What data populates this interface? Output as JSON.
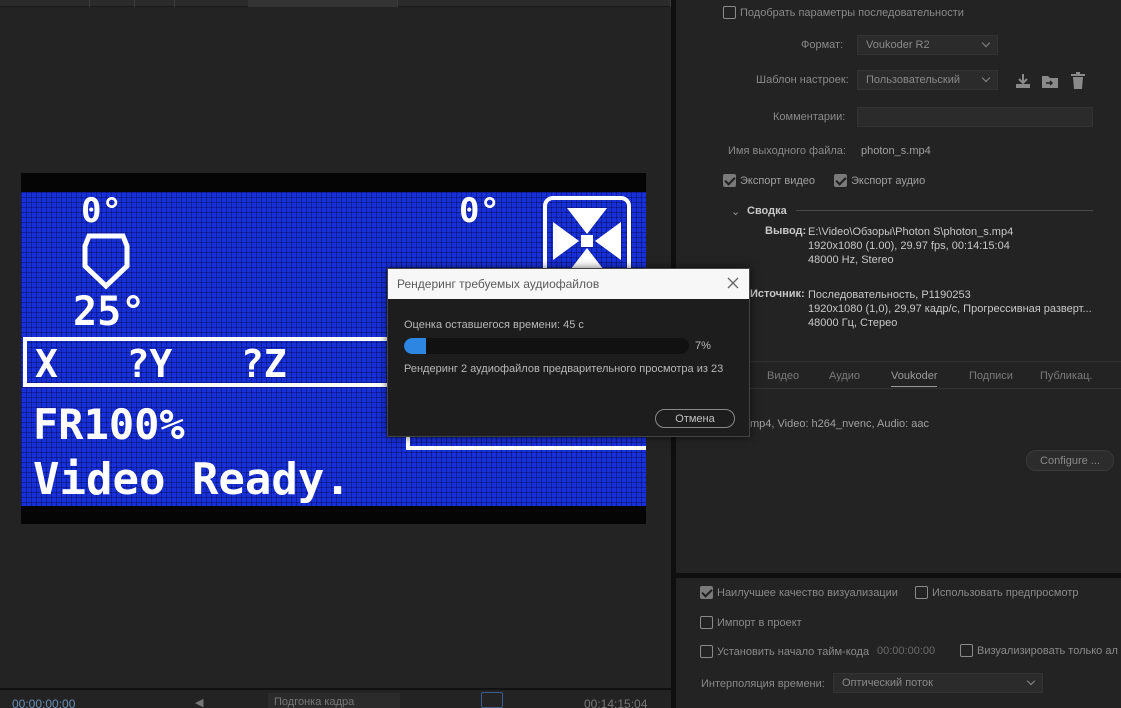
{
  "export_settings": {
    "match_sequence_label": "Подобрать параметры последовательности",
    "format_label": "Формат:",
    "format_value": "Voukoder R2",
    "preset_label": "Шаблон настроек:",
    "preset_value": "Пользовательский",
    "comments_label": "Комментарии:",
    "comments_value": "",
    "output_name_label": "Имя выходного файла:",
    "output_name_value": "photon_s.mp4",
    "export_video_label": "Экспорт видео",
    "export_audio_label": "Экспорт аудио",
    "summary_header": "Сводка",
    "output_label": "Вывод:",
    "output_lines": [
      "E:\\Video\\Обзоры\\Photon S\\photon_s.mp4",
      "1920x1080 (1.00), 29.97 fps, 00:14:15:04",
      "48000 Hz, Stereo"
    ],
    "source_label": "Источник:",
    "source_lines": [
      "Последовательность, P1190253",
      "1920x1080 (1,0), 29,97 кадр/с, Прогрессивная разверт...",
      "48000 Гц, Стерео"
    ],
    "tabs": [
      {
        "label": "Видео"
      },
      {
        "label": "Аудио"
      },
      {
        "label": "Voukoder"
      },
      {
        "label": "Подписи"
      },
      {
        "label": "Публикац."
      }
    ],
    "voukoder_summary": "mp4, Video: h264_nvenc, Audio: aac",
    "configure_label": "Configure ..."
  },
  "render_options": {
    "max_quality_label": "Наилучшее качество визуализации",
    "use_previews_label": "Использовать предпросмотр",
    "import_label": "Импорт в проект",
    "set_start_tc_label": "Установить начало тайм-кода",
    "start_tc_value": "00:00:00:00",
    "render_alpha_label": "Визуализировать только ал",
    "time_interp_label": "Интерполяция времени:",
    "time_interp_value": "Оптический поток"
  },
  "modal": {
    "title": "Рендеринг требуемых аудиофайлов",
    "time_remaining": "Оценка оставшегося времени: 45 с",
    "progress_fraction": 0.07,
    "progress_label": "7%",
    "status": "Рендеринг 2 аудиофайлов предварительного просмотра из 23",
    "cancel_label": "Отмена"
  },
  "preview": {
    "temp_nozzle": "0°",
    "temp_bed": "0°",
    "temp_target": "25°",
    "xyz_line": "X   ?Y   ?Z",
    "feedrate": "FR100%",
    "status_line": "Video Ready."
  },
  "timecode_bar": {
    "left_timecode": "00:00:00:00",
    "fit_label": "Подгонка кадра",
    "right_timecode": "00:14:15:04"
  },
  "colors": {
    "accent_progress": "#2d87e2",
    "lcd_blue": "#1830d8"
  },
  "icons": {
    "save_preset": "download-icon",
    "import_preset": "folder-import-icon",
    "delete_preset": "trash-icon",
    "close_modal": "close-icon"
  }
}
